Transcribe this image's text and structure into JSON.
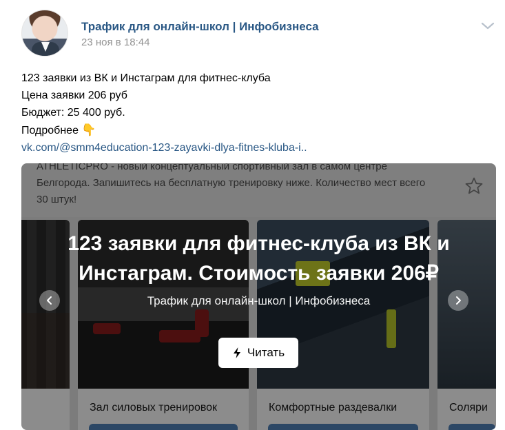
{
  "post": {
    "author": "Трафик для онлайн-школ | Инфобизнеса",
    "date": "23 ноя в 18:44",
    "lines": [
      "123 заявки из ВК и Инстаграм для фитнес-клуба",
      "Цена заявки 206 руб",
      "Бюджет: 25 400 руб.",
      "Подробнее"
    ],
    "hand_icon": "👇",
    "link": "vk.com/@smm4education-123-zayavki-dlya-fitnes-kluba-i.."
  },
  "card": {
    "ad_lines": [
      "ATHLETICPRO - новый концептуальный спортивный зал в самом центре",
      "Белгорода. Запишитесь на бесплатную тренировку ниже. Количество мест всего",
      "30 штук!"
    ],
    "title_lines": [
      "123 заявки для фитнес-клуба из ВК и",
      "Инстаграм. Стоимость заявки 206₽"
    ],
    "source": "Трафик для онлайн-школ | Инфобизнеса",
    "read_label": "Читать",
    "slides": [
      {
        "caption": ""
      },
      {
        "caption": "Зал силовых тренировок"
      },
      {
        "caption": "Комфортные раздевалки"
      },
      {
        "caption": "Соляри"
      }
    ]
  },
  "icons": {
    "more": "chevron-down-icon",
    "star": "star-icon",
    "lightning": "lightning-icon",
    "prev": "chevron-left-icon",
    "next": "chevron-right-icon"
  },
  "colors": {
    "link": "#2a5885",
    "muted": "#939393",
    "button": "#5181b8"
  }
}
